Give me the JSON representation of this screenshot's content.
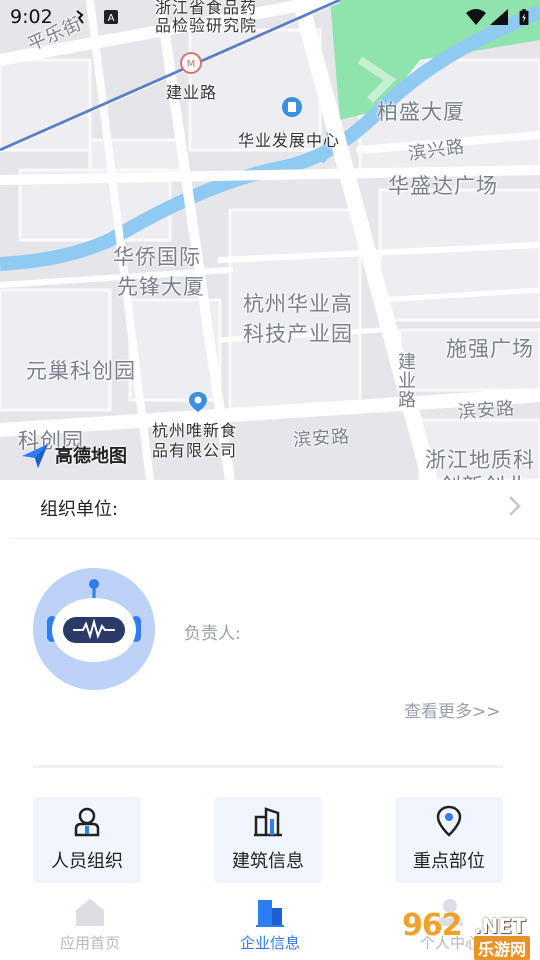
{
  "status_bar": {
    "time": "9:02"
  },
  "map": {
    "labels": {
      "pingle": "平乐街",
      "inspection_1": "浙江省食品药",
      "inspection_2": "品检验研究院",
      "jianye_station": "建业路",
      "huaye_center": "华业发展中心",
      "baisheng": "柏盛大厦",
      "binxing_road": "滨兴路",
      "huashengda": "华盛达广场",
      "huaqiao_1": "华侨国际",
      "huaqiao_2": "先锋大厦",
      "hightech_1": "杭州华业高",
      "hightech_2": "科技产业园",
      "shiqiang": "施强广场",
      "yuanchao": "元巢科创园",
      "jianye_road_vertical": "建业路",
      "binan_road_1": "滨安路",
      "binan_road_2": "滨安路",
      "weixin_1": "杭州唯新食",
      "weixin_2": "品有限公司",
      "kechuang_partial": "科创园",
      "geology_1": "浙江地质科",
      "geology_2": "创新创业"
    },
    "logo_text": "高德地图"
  },
  "org": {
    "label": "组织单位:"
  },
  "leader": {
    "label": "负责人:"
  },
  "more_link": "查看更多>>",
  "quick_actions": [
    {
      "label": "人员组织",
      "icon": "person-icon"
    },
    {
      "label": "建筑信息",
      "icon": "building-icon"
    },
    {
      "label": "重点部位",
      "icon": "location-pin-icon"
    }
  ],
  "bottom_nav": {
    "items": [
      {
        "label": "应用首页",
        "icon": "home-icon",
        "active": false
      },
      {
        "label": "企业信息",
        "icon": "building-icon",
        "active": true
      },
      {
        "label": "个人中心",
        "icon": "user-icon",
        "active": false
      }
    ]
  },
  "watermark": {
    "number": "962",
    "domain": ".NET",
    "site": "乐游网"
  },
  "colors": {
    "accent": "#2e7cf6",
    "map_bg": "#e6e6ea",
    "river": "#8fcaf3",
    "park": "#8fe4ad",
    "card_bg": "#f1f6fe",
    "avatar_bg": "#bcd2f6"
  }
}
